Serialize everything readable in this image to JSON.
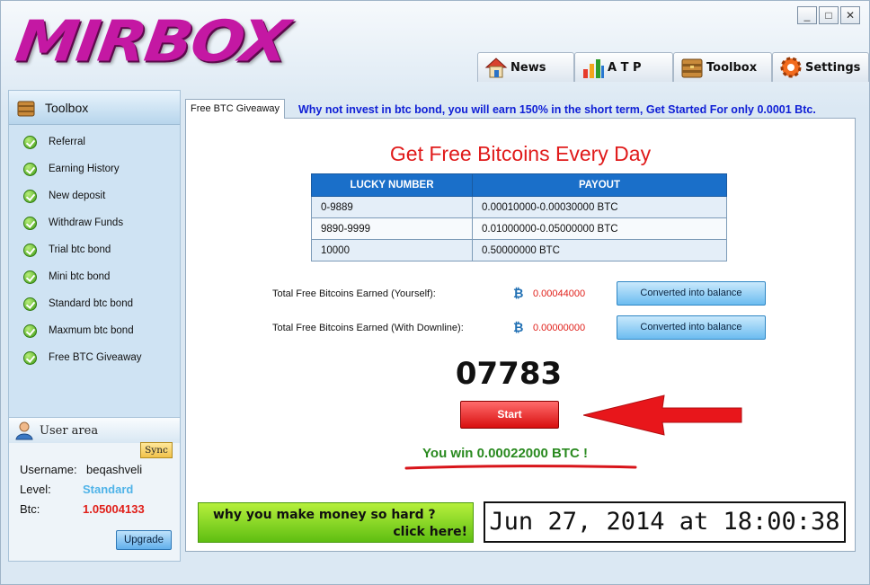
{
  "app": {
    "logo_text": "MIRBOX"
  },
  "window_controls": {
    "minimize": "_",
    "maximize": "□",
    "close": "✕"
  },
  "nav": {
    "news": "News",
    "atp": "A T P",
    "toolbox": "Toolbox",
    "settings": "Settings"
  },
  "sidebar": {
    "title": "Toolbox",
    "items": [
      {
        "label": "Referral"
      },
      {
        "label": "Earning History"
      },
      {
        "label": "New deposit"
      },
      {
        "label": "Withdraw Funds"
      },
      {
        "label": "Trial btc bond"
      },
      {
        "label": "Mini btc bond"
      },
      {
        "label": "Standard btc bond"
      },
      {
        "label": "Maxmum btc bond"
      },
      {
        "label": "Free BTC Giveaway"
      }
    ]
  },
  "user_area": {
    "title": "User area",
    "sync_label": "Sync",
    "username_label": "Username:",
    "username": "beqashveli",
    "level_label": "Level:",
    "level": "Standard",
    "btc_label": "Btc:",
    "btc": "1.05004133",
    "upgrade_label": "Upgrade"
  },
  "main": {
    "tab_label": "Free BTC Giveaway",
    "marquee": "Why not invest in btc bond, you will earn 150% in the short term, Get Started For only 0.0001 Btc.",
    "title": "Get Free Bitcoins Every Day",
    "table": {
      "headers": [
        "LUCKY NUMBER",
        "PAYOUT"
      ],
      "rows": [
        [
          "0-9889",
          "0.00010000-0.00030000 BTC"
        ],
        [
          "9890-9999",
          "0.01000000-0.05000000 BTC"
        ],
        [
          "10000",
          "0.50000000 BTC"
        ]
      ]
    },
    "earned_self_label": "Total Free Bitcoins Earned (Yourself):",
    "earned_self_value": "0.00044000",
    "earned_downline_label": "Total Free Bitcoins Earned (With Downline):",
    "earned_downline_value": "0.00000000",
    "btc_symbol": "₿",
    "convert_label": "Converted into balance",
    "lucky_number": "07783",
    "start_label": "Start",
    "win_message": "You win 0.00022000 BTC !",
    "promo_line1": "why you make money so hard ?",
    "promo_line2": "click here!",
    "clock": "Jun 27, 2014 at 18:00:38"
  },
  "colors": {
    "logo": "#c418a3",
    "accent_blue": "#1a6fc9",
    "title_red": "#e01b1b",
    "win_green": "#2a8a20",
    "level_blue": "#4fb3e8",
    "btc_red": "#e0201a"
  }
}
